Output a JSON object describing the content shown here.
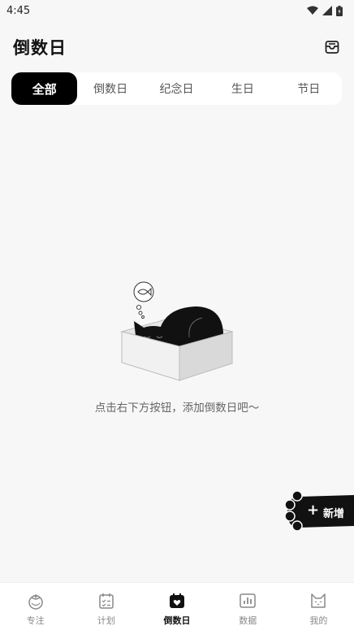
{
  "status_bar": {
    "time": "4:45"
  },
  "header": {
    "title": "倒数日"
  },
  "tabs": [
    {
      "label": "全部",
      "active": true
    },
    {
      "label": "倒数日",
      "active": false
    },
    {
      "label": "纪念日",
      "active": false
    },
    {
      "label": "生日",
      "active": false
    },
    {
      "label": "节日",
      "active": false
    }
  ],
  "empty_state": {
    "message": "点击右下方按钮，添加倒数日吧～"
  },
  "add_button": {
    "label": "新增"
  },
  "bottom_nav": [
    {
      "label": "专注",
      "icon": "tomato-icon",
      "active": false
    },
    {
      "label": "计划",
      "icon": "calendar-check-icon",
      "active": false
    },
    {
      "label": "倒数日",
      "icon": "calendar-heart-icon",
      "active": true
    },
    {
      "label": "数据",
      "icon": "bar-chart-icon",
      "active": false
    },
    {
      "label": "我的",
      "icon": "cat-face-icon",
      "active": false
    }
  ],
  "colors": {
    "accent": "#000000",
    "background": "#f7f7f7",
    "inactive": "#888888"
  }
}
